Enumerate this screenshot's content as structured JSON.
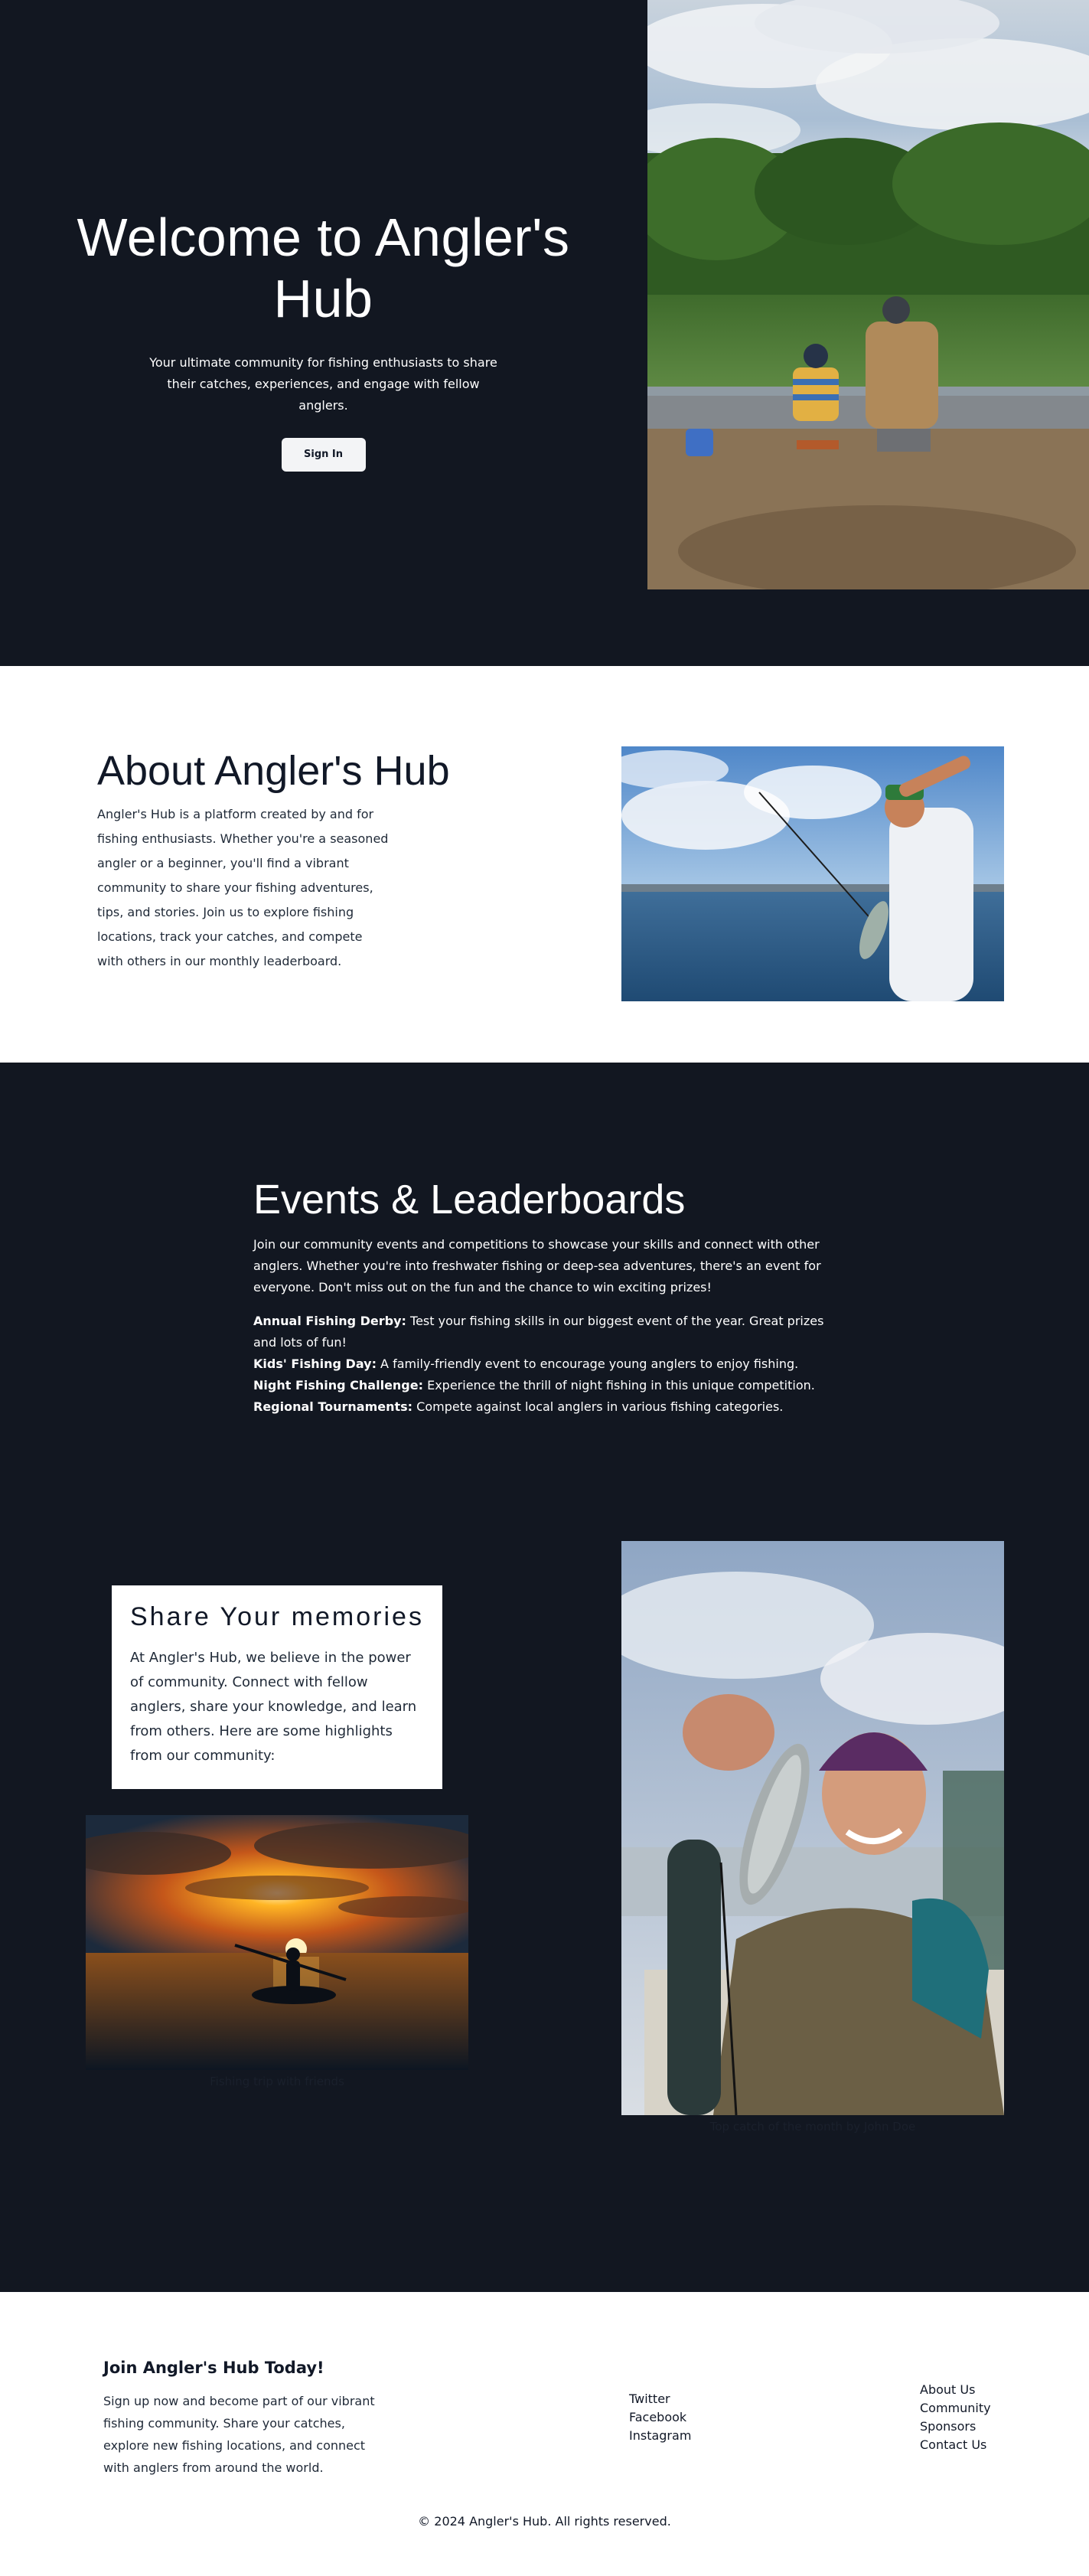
{
  "hero": {
    "title": "Welcome to Angler's Hub",
    "subtitle": "Your ultimate community for fishing enthusiasts to share their catches, experiences, and engage with fellow anglers.",
    "signin_label": "Sign In"
  },
  "about": {
    "title": "About Angler's Hub",
    "body": "Angler's Hub is a platform created by and for fishing enthusiasts. Whether you're a seasoned angler or a beginner, you'll find a vibrant community to share your fishing adventures, tips, and stories. Join us to explore fishing locations, track your catches, and compete with others in our monthly leaderboard."
  },
  "events": {
    "title": "Events & Leaderboards",
    "intro": "Join our community events and competitions to showcase your skills and connect with other anglers. Whether you're into freshwater fishing or deep-sea adventures, there's an event for everyone. Don't miss out on the fun and the chance to win exciting prizes!",
    "items": [
      {
        "name": "Annual Fishing Derby:",
        "desc": " Test your fishing skills in our biggest event of the year. Great prizes and lots of fun!"
      },
      {
        "name": "Kids' Fishing Day:",
        "desc": " A family-friendly event to encourage young anglers to enjoy fishing."
      },
      {
        "name": "Night Fishing Challenge:",
        "desc": " Experience the thrill of night fishing in this unique competition."
      },
      {
        "name": "Regional Tournaments:",
        "desc": " Compete against local anglers in various fishing categories."
      }
    ]
  },
  "memories": {
    "title": "Share Your memories",
    "body": "At Angler's Hub, we believe in the power of community. Connect with fellow anglers, share your knowledge, and learn from others. Here are some highlights from our community:",
    "captions": {
      "kayak": "Fishing trip with friends",
      "angler": "Top catch of the month by John Doe"
    }
  },
  "footer": {
    "join_title": "Join Angler's Hub Today!",
    "join_body": "Sign up now and become part of our vibrant fishing community. Share your catches, explore new fishing locations, and connect with anglers from around the world.",
    "social": [
      "Twitter",
      "Facebook",
      "Instagram"
    ],
    "links": [
      "About Us",
      "Community",
      "Sponsors",
      "Contact Us"
    ],
    "copyright": "© 2024 Angler's Hub. All rights reserved."
  }
}
